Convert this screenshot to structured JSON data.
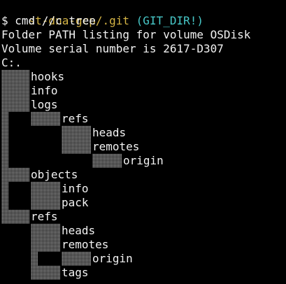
{
  "prompt": {
    "path": "st-dna-gcp/.git",
    "git_dir": "(GIT_DIR!)",
    "command": "$ cmd //c tree"
  },
  "output": {
    "header_line": "Folder PATH listing for volume OSDisk",
    "serial_line": "Volume serial number is 2617-D307",
    "drive_line": "C:."
  },
  "tree": {
    "hooks": "hooks",
    "info": "info",
    "logs": "logs",
    "logs_refs": "refs",
    "logs_heads": "heads",
    "logs_remotes": "remotes",
    "logs_origin": "origin",
    "objects": "objects",
    "objects_info": "info",
    "objects_pack": "pack",
    "refs": "refs",
    "refs_heads": "heads",
    "refs_remotes": "remotes",
    "refs_origin": "origin",
    "refs_tags": "tags"
  },
  "colors": {
    "background": "#000000",
    "text": "#f2f2f2",
    "path": "#d6b545",
    "git_dir": "#48c9c9"
  }
}
